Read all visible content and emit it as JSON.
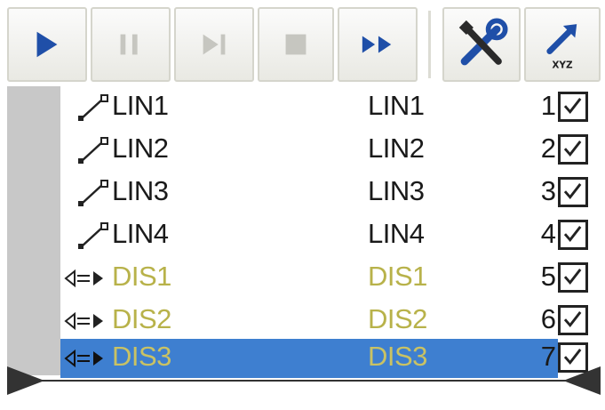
{
  "toolbar": {
    "buttons": [
      {
        "name": "play-icon",
        "enabled": true
      },
      {
        "name": "pause-icon",
        "enabled": false
      },
      {
        "name": "step-icon",
        "enabled": false
      },
      {
        "name": "stop-icon",
        "enabled": false
      },
      {
        "name": "fast-forward-icon",
        "enabled": true
      },
      {
        "name": "tools-icon",
        "enabled": true
      },
      {
        "name": "xyz-arrow-icon",
        "enabled": true,
        "label": "XYZ"
      }
    ],
    "accent": "#1f4fa8"
  },
  "rows": [
    {
      "type": "LIN",
      "icon": "linear-move-icon",
      "name": "LIN1",
      "name2": "LIN1",
      "num": "1",
      "checked": true
    },
    {
      "type": "LIN",
      "icon": "linear-move-icon",
      "name": "LIN2",
      "name2": "LIN2",
      "num": "2",
      "checked": true
    },
    {
      "type": "LIN",
      "icon": "linear-move-icon",
      "name": "LIN3",
      "name2": "LIN3",
      "num": "3",
      "checked": true
    },
    {
      "type": "LIN",
      "icon": "linear-move-icon",
      "name": "LIN4",
      "name2": "LIN4",
      "num": "4",
      "checked": true
    },
    {
      "type": "DIS",
      "icon": "distance-icon",
      "name": "DIS1",
      "name2": "DIS1",
      "num": "5",
      "checked": true
    },
    {
      "type": "DIS",
      "icon": "distance-icon",
      "name": "DIS2",
      "name2": "DIS2",
      "num": "6",
      "checked": true
    },
    {
      "type": "DIS",
      "icon": "distance-icon",
      "name": "DIS3",
      "name2": "DIS3",
      "num": "7",
      "checked": true,
      "selected": true
    }
  ],
  "colors": {
    "selection": "#3e7fd0",
    "dis_text": "#b8b24a",
    "gutter": "#c8c8c8"
  }
}
